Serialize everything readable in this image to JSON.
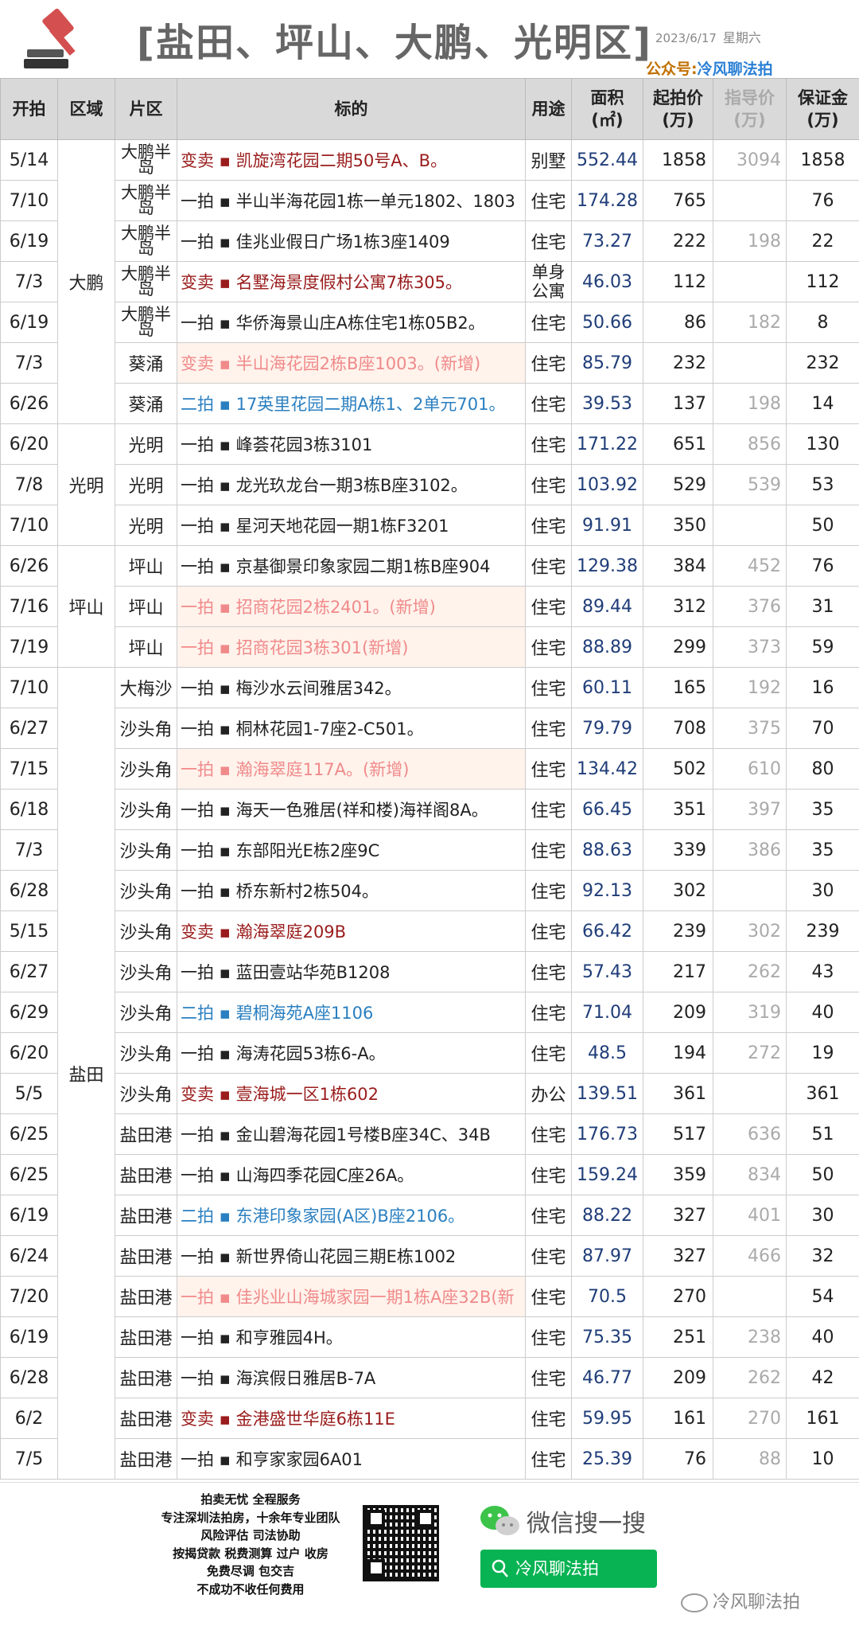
{
  "header": {
    "title": "[盐田、坪山、大鹏、光明区]",
    "date": "2023/6/17",
    "weekday": "星期六",
    "account_label": "公众号:",
    "account_name": "冷风聊法拍"
  },
  "table": {
    "headers": {
      "open": "开拍",
      "region": "区域",
      "subarea": "片区",
      "target": "标的",
      "use": "用途",
      "area_label": "面积",
      "area_unit": "(㎡)",
      "start_label": "起拍价",
      "start_unit": "(万)",
      "guide_label": "指导价",
      "guide_unit": "(万)",
      "deposit_label": "保证金",
      "deposit_unit": "(万)"
    },
    "rows": [
      {
        "date": "5/14",
        "region": "大鹏",
        "sub": "大鹏半岛",
        "title": "变卖 ▪ 凯旋湾花园二期50号A、B。",
        "use": "别墅",
        "area": "552.44",
        "start": "1858",
        "guide": "3094",
        "deposit": "1858",
        "style": "red"
      },
      {
        "date": "7/10",
        "sub": "大鹏半岛",
        "title": "一拍 ▪ 半山半海花园1栋一单元1802、1803",
        "use": "住宅",
        "area": "174.28",
        "start": "765",
        "guide": "",
        "deposit": "76",
        "style": "normal"
      },
      {
        "date": "6/19",
        "sub": "大鹏半岛",
        "title": "一拍 ▪ 佳兆业假日广场1栋3座1409",
        "use": "住宅",
        "area": "73.27",
        "start": "222",
        "guide": "198",
        "deposit": "22",
        "style": "normal"
      },
      {
        "date": "7/3",
        "sub": "大鹏半岛",
        "title": "变卖 ▪ 名墅海景度假村公寓7栋305。",
        "use": "单身公寓",
        "area": "46.03",
        "start": "112",
        "guide": "",
        "deposit": "112",
        "style": "red"
      },
      {
        "date": "6/19",
        "sub": "大鹏半岛",
        "title": "一拍 ▪ 华侨海景山庄A栋住宅1栋05B2。",
        "use": "住宅",
        "area": "50.66",
        "start": "86",
        "guide": "182",
        "deposit": "8",
        "style": "normal"
      },
      {
        "date": "7/3",
        "sub": "葵涌",
        "title": "变卖 ▪ 半山海花园2栋B座1003。(新增)",
        "use": "住宅",
        "area": "85.79",
        "start": "232",
        "guide": "",
        "deposit": "232",
        "style": "new"
      },
      {
        "date": "6/26",
        "sub": "葵涌",
        "title": "二拍 ▪ 17英里花园二期A栋1、2单元701。",
        "use": "住宅",
        "area": "39.53",
        "start": "137",
        "guide": "198",
        "deposit": "14",
        "style": "blue"
      },
      {
        "date": "6/20",
        "region": "光明",
        "sub": "光明",
        "title": "一拍 ▪ 峰荟花园3栋3101",
        "use": "住宅",
        "area": "171.22",
        "start": "651",
        "guide": "856",
        "deposit": "130",
        "style": "normal"
      },
      {
        "date": "7/8",
        "sub": "光明",
        "title": "一拍 ▪ 龙光玖龙台一期3栋B座3102。",
        "use": "住宅",
        "area": "103.92",
        "start": "529",
        "guide": "539",
        "deposit": "53",
        "style": "normal"
      },
      {
        "date": "7/10",
        "sub": "光明",
        "title": "一拍 ▪ 星河天地花园一期1栋F3201",
        "use": "住宅",
        "area": "91.91",
        "start": "350",
        "guide": "",
        "deposit": "50",
        "style": "normal"
      },
      {
        "date": "6/26",
        "region": "坪山",
        "sub": "坪山",
        "title": "一拍 ▪ 京基御景印象家园二期1栋B座904",
        "use": "住宅",
        "area": "129.38",
        "start": "384",
        "guide": "452",
        "deposit": "76",
        "style": "normal"
      },
      {
        "date": "7/16",
        "sub": "坪山",
        "title": "一拍 ▪ 招商花园2栋2401。(新增)",
        "use": "住宅",
        "area": "89.44",
        "start": "312",
        "guide": "376",
        "deposit": "31",
        "style": "new"
      },
      {
        "date": "7/19",
        "sub": "坪山",
        "title": "一拍 ▪ 招商花园3栋301(新增)",
        "use": "住宅",
        "area": "88.89",
        "start": "299",
        "guide": "373",
        "deposit": "59",
        "style": "new"
      },
      {
        "date": "7/10",
        "region": "盐田",
        "sub": "大梅沙",
        "title": "一拍 ▪ 梅沙水云间雅居342。",
        "use": "住宅",
        "area": "60.11",
        "start": "165",
        "guide": "192",
        "deposit": "16",
        "style": "normal"
      },
      {
        "date": "6/27",
        "sub": "沙头角",
        "title": "一拍 ▪ 桐林花园1-7座2-C501。",
        "use": "住宅",
        "area": "79.79",
        "start": "708",
        "guide": "375",
        "deposit": "70",
        "style": "normal"
      },
      {
        "date": "7/15",
        "sub": "沙头角",
        "title": "一拍 ▪ 瀚海翠庭117A。(新增)",
        "use": "住宅",
        "area": "134.42",
        "start": "502",
        "guide": "610",
        "deposit": "80",
        "style": "new"
      },
      {
        "date": "6/18",
        "sub": "沙头角",
        "title": "一拍 ▪ 海天一色雅居(祥和楼)海祥阁8A。",
        "use": "住宅",
        "area": "66.45",
        "start": "351",
        "guide": "397",
        "deposit": "35",
        "style": "normal"
      },
      {
        "date": "7/3",
        "sub": "沙头角",
        "title": "一拍 ▪ 东部阳光E栋2座9C",
        "use": "住宅",
        "area": "88.63",
        "start": "339",
        "guide": "386",
        "deposit": "35",
        "style": "normal"
      },
      {
        "date": "6/28",
        "sub": "沙头角",
        "title": "一拍 ▪ 桥东新村2栋504。",
        "use": "住宅",
        "area": "92.13",
        "start": "302",
        "guide": "",
        "deposit": "30",
        "style": "normal"
      },
      {
        "date": "5/15",
        "sub": "沙头角",
        "title": "变卖 ▪ 瀚海翠庭209B",
        "use": "住宅",
        "area": "66.42",
        "start": "239",
        "guide": "302",
        "deposit": "239",
        "style": "red"
      },
      {
        "date": "6/27",
        "sub": "沙头角",
        "title": "一拍 ▪ 蓝田壹站华苑B1208",
        "use": "住宅",
        "area": "57.43",
        "start": "217",
        "guide": "262",
        "deposit": "43",
        "style": "normal"
      },
      {
        "date": "6/29",
        "sub": "沙头角",
        "title": "二拍 ▪ 碧桐海苑A座1106",
        "use": "住宅",
        "area": "71.04",
        "start": "209",
        "guide": "319",
        "deposit": "40",
        "style": "blue"
      },
      {
        "date": "6/20",
        "sub": "沙头角",
        "title": "一拍 ▪ 海涛花园53栋6-A。",
        "use": "住宅",
        "area": "48.5",
        "start": "194",
        "guide": "272",
        "deposit": "19",
        "style": "normal"
      },
      {
        "date": "5/5",
        "sub": "沙头角",
        "title": "变卖 ▪ 壹海城一区1栋602",
        "use": "办公",
        "area": "139.51",
        "start": "361",
        "guide": "",
        "deposit": "361",
        "style": "red"
      },
      {
        "date": "6/25",
        "sub": "盐田港",
        "title": "一拍 ▪ 金山碧海花园1号楼B座34C、34B",
        "use": "住宅",
        "area": "176.73",
        "start": "517",
        "guide": "636",
        "deposit": "51",
        "style": "normal"
      },
      {
        "date": "6/25",
        "sub": "盐田港",
        "title": "一拍 ▪ 山海四季花园C座26A。",
        "use": "住宅",
        "area": "159.24",
        "start": "359",
        "guide": "834",
        "deposit": "50",
        "style": "normal"
      },
      {
        "date": "6/19",
        "sub": "盐田港",
        "title": "二拍 ▪ 东港印象家园(A区)B座2106。",
        "use": "住宅",
        "area": "88.22",
        "start": "327",
        "guide": "401",
        "deposit": "30",
        "style": "blue"
      },
      {
        "date": "6/24",
        "sub": "盐田港",
        "title": "一拍 ▪ 新世界倚山花园三期E栋1002",
        "use": "住宅",
        "area": "87.97",
        "start": "327",
        "guide": "466",
        "deposit": "32",
        "style": "normal"
      },
      {
        "date": "7/20",
        "sub": "盐田港",
        "title": "一拍 ▪ 佳兆业山海城家园一期1栋A座32B(新",
        "use": "住宅",
        "area": "70.5",
        "start": "270",
        "guide": "",
        "deposit": "54",
        "style": "new"
      },
      {
        "date": "6/19",
        "sub": "盐田港",
        "title": "一拍 ▪ 和亨雅园4H。",
        "use": "住宅",
        "area": "75.35",
        "start": "251",
        "guide": "238",
        "deposit": "40",
        "style": "normal"
      },
      {
        "date": "6/28",
        "sub": "盐田港",
        "title": "一拍 ▪ 海滨假日雅居B-7A",
        "use": "住宅",
        "area": "46.77",
        "start": "209",
        "guide": "262",
        "deposit": "42",
        "style": "normal"
      },
      {
        "date": "6/2",
        "sub": "盐田港",
        "title": "变卖 ▪ 金港盛世华庭6栋11E",
        "use": "住宅",
        "area": "59.95",
        "start": "161",
        "guide": "270",
        "deposit": "161",
        "style": "red"
      },
      {
        "date": "7/5",
        "sub": "盐田港",
        "title": "一拍 ▪ 和亨家家园6A01",
        "use": "住宅",
        "area": "25.39",
        "start": "76",
        "guide": "88",
        "deposit": "10",
        "style": "normal"
      }
    ]
  },
  "footer": {
    "slogan": [
      "拍卖无忧 全程服务",
      "专注深圳法拍房，十余年专业团队",
      "风险评估 司法协助",
      "按揭贷款 税费测算 过户 收房",
      "免费尽调 包交吉",
      "不成功不收任何费用"
    ],
    "wechat_search": "微信搜一搜",
    "search_button": "冷风聊法拍",
    "watermark": "冷风聊法拍"
  },
  "colors": {
    "red_text": "#9a1c1c",
    "blue_text": "#2a7fc0",
    "new_text": "#f08a8a",
    "new_bg": "#fff3ec",
    "header_bg": "#d9d9d9",
    "wechat_green": "#07b352",
    "account_label": "#c07000",
    "account_name": "#2a7fd4"
  },
  "icons": {
    "logo": "gavel-icon",
    "qr": "qr-code-icon",
    "wechat": "wechat-icon",
    "search": "search-icon"
  }
}
